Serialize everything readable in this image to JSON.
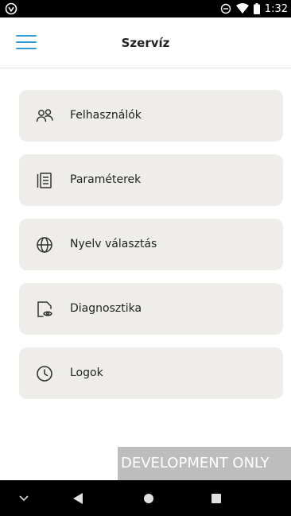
{
  "status_bar": {
    "time": "1:32",
    "icons": [
      "app-notification-icon",
      "do-not-disturb-icon",
      "wifi-icon",
      "battery-icon"
    ]
  },
  "app_bar": {
    "title": "Szervíz",
    "menu_icon": "hamburger-menu-icon",
    "accent_color": "#2a9fd6"
  },
  "menu": {
    "items": [
      {
        "label": "Felhasználók",
        "icon": "users-icon"
      },
      {
        "label": "Paraméterek",
        "icon": "documents-icon"
      },
      {
        "label": "Nyelv választás",
        "icon": "globe-icon"
      },
      {
        "label": "Diagnosztika",
        "icon": "file-eye-icon"
      },
      {
        "label": "Logok",
        "icon": "clock-icon"
      }
    ],
    "item_background": "#eeedea"
  },
  "watermark": {
    "text": "DEVELOPMENT ONLY"
  },
  "nav_bar": {
    "buttons": [
      "chevron-down-icon",
      "back-icon",
      "home-icon",
      "recents-icon"
    ]
  }
}
